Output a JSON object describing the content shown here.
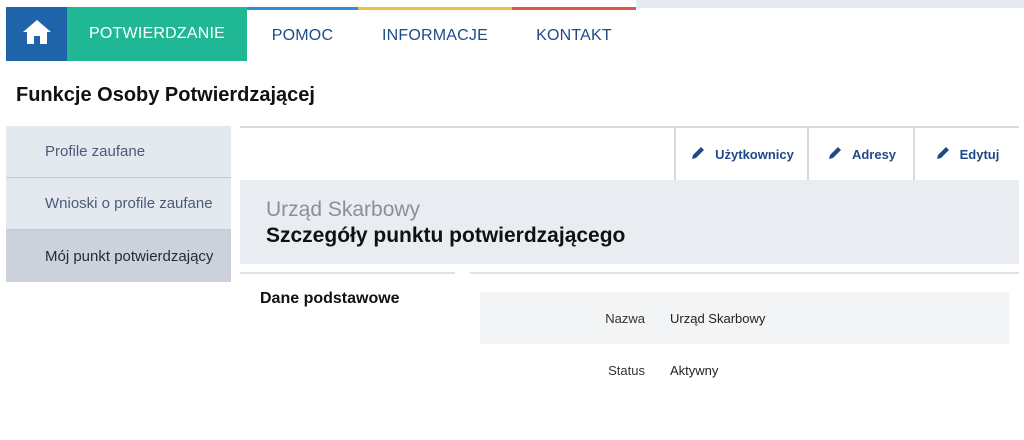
{
  "nav": {
    "home_icon": "home-icon",
    "items": [
      {
        "label": "POTWIERDZANIE",
        "active": true,
        "accent": "#20b894"
      },
      {
        "label": "POMOC",
        "accent": "#2e8fd8"
      },
      {
        "label": "INFORMACJE",
        "accent": "#efc23e"
      },
      {
        "label": "KONTAKT",
        "accent": "#e25544"
      }
    ]
  },
  "page": {
    "title": "Funkcje Osoby Potwierdzającej"
  },
  "sidebar": {
    "items": [
      {
        "label": "Profile zaufane"
      },
      {
        "label": "Wnioski o profile zaufane"
      },
      {
        "label": "Mój punkt potwierdzający",
        "active": true
      }
    ]
  },
  "toolbar": {
    "users_label": "Użytkownicy",
    "addresses_label": "Adresy",
    "edit_label": "Edytuj",
    "icon": "pencil-icon"
  },
  "panel": {
    "office": "Urząd Skarbowy",
    "title": "Szczegóły punktu potwierdzającego"
  },
  "details": {
    "section_label": "Dane podstawowe",
    "rows": [
      {
        "key": "Nazwa",
        "value": "Urząd Skarbowy"
      },
      {
        "key": "Status",
        "value": "Aktywny"
      }
    ]
  },
  "colors": {
    "brand_blue": "#1f63a8",
    "accent_green": "#20b894",
    "link_blue": "#1f4a88"
  }
}
